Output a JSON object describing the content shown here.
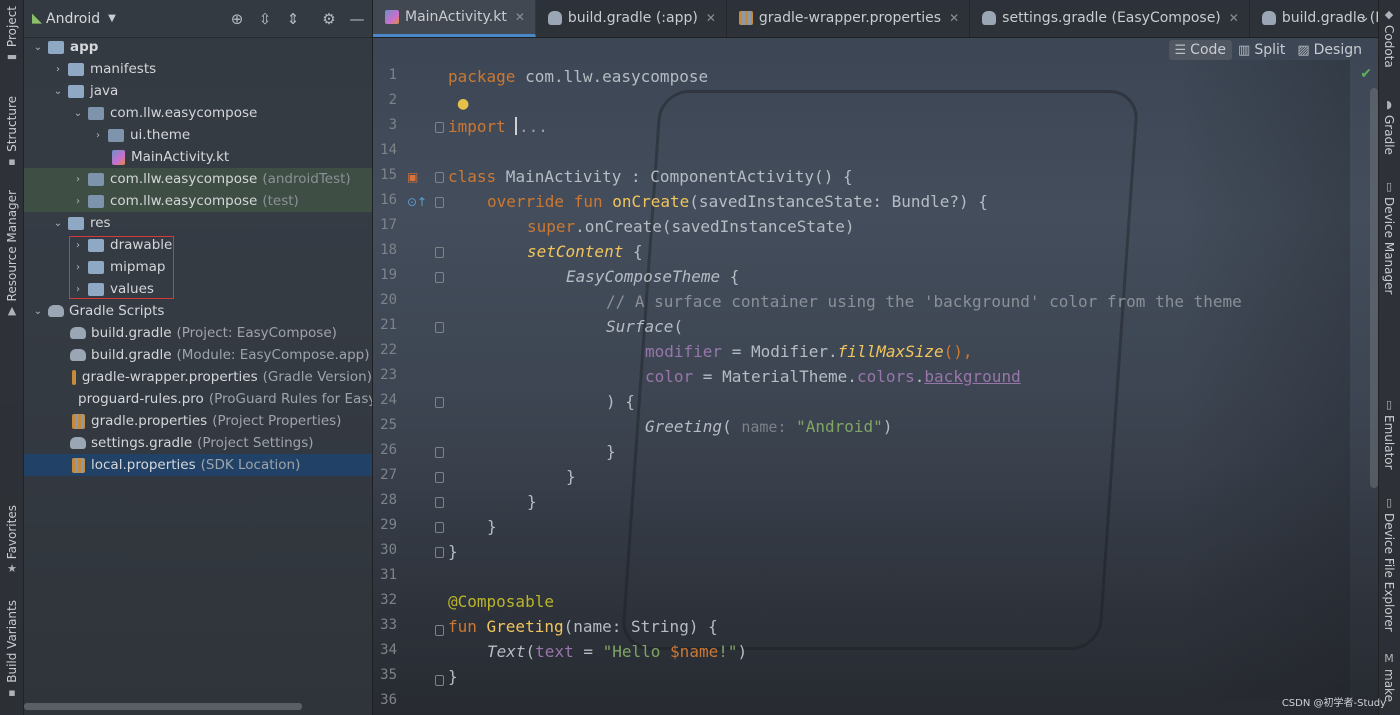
{
  "left_stripe": {
    "tabs": [
      "Project",
      "Structure",
      "Resource Manager",
      "Favorites",
      "Build Variants"
    ]
  },
  "right_stripe": {
    "tabs": [
      "Codota",
      "Gradle",
      "Device Manager",
      "Emulator",
      "Device File Explorer",
      "make"
    ]
  },
  "project_panel": {
    "view_mode": "Android",
    "tree": [
      {
        "label": "app",
        "hint": "",
        "icon": "folder",
        "expanded": true
      },
      {
        "label": "manifests",
        "hint": "",
        "icon": "folder",
        "expanded": false
      },
      {
        "label": "java",
        "hint": "",
        "icon": "folder",
        "expanded": true
      },
      {
        "label": "com.llw.easycompose",
        "hint": "",
        "icon": "package",
        "expanded": true
      },
      {
        "label": "ui.theme",
        "hint": "",
        "icon": "package",
        "expanded": false
      },
      {
        "label": "MainActivity.kt",
        "hint": "",
        "icon": "kotlin-file"
      },
      {
        "label": "com.llw.easycompose",
        "hint": "(androidTest)",
        "icon": "package",
        "expanded": false
      },
      {
        "label": "com.llw.easycompose",
        "hint": "(test)",
        "icon": "package",
        "expanded": false
      },
      {
        "label": "res",
        "hint": "",
        "icon": "folder",
        "expanded": true
      },
      {
        "label": "drawable",
        "hint": "",
        "icon": "folder",
        "expanded": false
      },
      {
        "label": "mipmap",
        "hint": "",
        "icon": "folder",
        "expanded": false
      },
      {
        "label": "values",
        "hint": "",
        "icon": "folder",
        "expanded": false
      },
      {
        "label": "Gradle Scripts",
        "hint": "",
        "icon": "gradle",
        "expanded": true
      },
      {
        "label": "build.gradle",
        "hint": "(Project: EasyCompose)",
        "icon": "gradle"
      },
      {
        "label": "build.gradle",
        "hint": "(Module: EasyCompose.app)",
        "icon": "gradle"
      },
      {
        "label": "gradle-wrapper.properties",
        "hint": "(Gradle Version)",
        "icon": "properties"
      },
      {
        "label": "proguard-rules.pro",
        "hint": "(ProGuard Rules for EasyC",
        "icon": "properties"
      },
      {
        "label": "gradle.properties",
        "hint": "(Project Properties)",
        "icon": "properties"
      },
      {
        "label": "settings.gradle",
        "hint": "(Project Settings)",
        "icon": "gradle"
      },
      {
        "label": "local.properties",
        "hint": "(SDK Location)",
        "icon": "properties",
        "selected": true
      }
    ]
  },
  "editor": {
    "tabs": [
      {
        "label": "MainActivity.kt",
        "active": true
      },
      {
        "label": "build.gradle (:app)"
      },
      {
        "label": "gradle-wrapper.properties"
      },
      {
        "label": "settings.gradle (EasyCompose)"
      },
      {
        "label": "build.gradle (EasyCompos"
      }
    ],
    "view_modes": [
      "Code",
      "Split",
      "Design"
    ],
    "active_view_mode": "Code",
    "line_numbers": [
      "1",
      "2",
      "3",
      "14",
      "15",
      "16",
      "17",
      "18",
      "19",
      "20",
      "21",
      "22",
      "23",
      "24",
      "25",
      "26",
      "27",
      "28",
      "29",
      "30",
      "31",
      "32",
      "33",
      "34",
      "35",
      "36"
    ],
    "code": {
      "l1_kw": "package",
      "l1_rest": " com.llw.easycompose",
      "l3_kw": "import ",
      "l3_dots": "...",
      "l15_kw": "class",
      "l15_rest": " MainActivity : ComponentActivity() {",
      "l16_kw": "override fun ",
      "l16_fn": "onCreate",
      "l16_rest": "(savedInstanceState: Bundle?) {",
      "l17_kw": "super",
      "l17_rest": ".onCreate(savedInstanceState)",
      "l18_fn": "setContent",
      "l18_rest": " {",
      "l19_it": "EasyComposeTheme",
      "l19_rest": " {",
      "l20_cm": "// A surface container using the 'background' color from the theme",
      "l21_it": "Surface",
      "l21_rest": "(",
      "l22_pm": "modifier",
      "l22_eq": " = Modifier.",
      "l22_fn": "fillMaxSize",
      "l22_rest": "(),",
      "l23_pm": "color",
      "l23_eq": " = MaterialTheme.",
      "l23_pm2": "colors",
      "l23_dot": ".",
      "l23_under": "background",
      "l24": ") {",
      "l25_it": "Greeting",
      "l25_paren": "( ",
      "l25_hint": "name:",
      "l25_str": " \"Android\"",
      "l25_rest": ")",
      "l26": "}",
      "l27": "}",
      "l28": "}",
      "l29": "}",
      "l30": "}",
      "l32_an": "@Composable",
      "l33_kw": "fun ",
      "l33_fn": "Greeting",
      "l33_rest": "(name: String) {",
      "l34_it": "Text",
      "l34_paren": "(",
      "l34_pm": "text",
      "l34_eq": " = ",
      "l34_str": "\"Hello ",
      "l34_var": "$name",
      "l34_str2": "!\"",
      "l34_rest": ")",
      "l35": "}"
    }
  },
  "watermark": "CSDN @初学者-Study"
}
